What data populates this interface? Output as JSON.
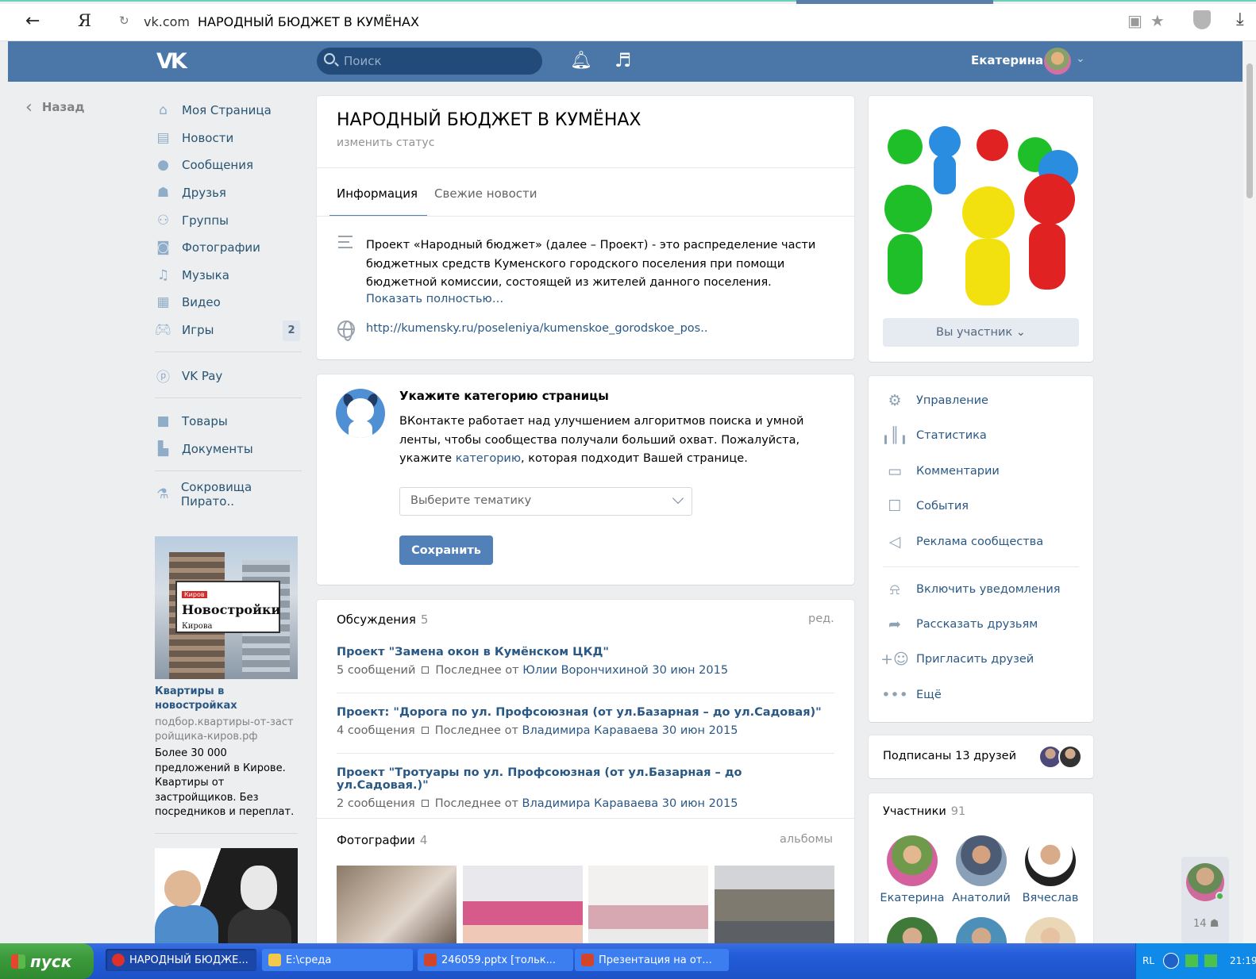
{
  "browser": {
    "back_glyph": "←",
    "ya_logo": "Я",
    "reload_glyph": "↻",
    "domain": "vk.com",
    "page_title": "НАРОДНЫЙ БЮДЖЕТ В КУМЁНАХ",
    "icons": [
      "lock-icon",
      "star-icon",
      "shield-icon",
      "download-icon"
    ]
  },
  "header": {
    "logo": "VK",
    "search_placeholder": "Поиск",
    "user_name": "Екатерина",
    "icons": [
      "bell-icon",
      "music-icon",
      "chevron-down-icon"
    ]
  },
  "back_label": "Назад",
  "left_nav": {
    "items": [
      {
        "label": "Моя Страница",
        "icon": "home-icon"
      },
      {
        "label": "Новости",
        "icon": "news-icon"
      },
      {
        "label": "Сообщения",
        "icon": "messages-icon"
      },
      {
        "label": "Друзья",
        "icon": "friend-icon"
      },
      {
        "label": "Группы",
        "icon": "groups-icon"
      },
      {
        "label": "Фотографии",
        "icon": "camera-icon"
      },
      {
        "label": "Музыка",
        "icon": "music-icon"
      },
      {
        "label": "Видео",
        "icon": "video-icon"
      },
      {
        "label": "Игры",
        "icon": "gamepad-icon",
        "badge": "2"
      }
    ],
    "pay": {
      "label": "VK Pay",
      "icon": "vkpay-icon"
    },
    "items2": [
      {
        "label": "Товары",
        "icon": "bag-icon"
      },
      {
        "label": "Документы",
        "icon": "document-icon"
      }
    ],
    "app": {
      "label": "Сокровища Пирато..",
      "icon": "flask-icon"
    }
  },
  "ads": {
    "ad1": {
      "tag": "Киров",
      "headline": "Новостройки",
      "sub": "Кирова",
      "title": "Квартиры в новостройках",
      "domain": "подбор.квартиры-от-застройщика-киров.рф",
      "text": "Более 30 000 предложений в Кирове. Квартиры от застройщиков. Без посредников и переплат."
    }
  },
  "group": {
    "title": "НАРОДНЫЙ БЮДЖЕТ В КУМЁНАХ",
    "status_link": "изменить статус",
    "tabs": [
      "Информация",
      "Свежие новости"
    ],
    "description": "Проект «Народный бюджет» (далее – Проект) - это распределение части бюджетных средств Куменского городского поселения при помощи бюджетной комиссии, состоящей из жителей данного поселения.",
    "show_more": "Показать полностью…",
    "website": "http://kumensky.ru/poseleniya/kumenskoe_gorodskoe_pos.."
  },
  "category": {
    "title": "Укажите категорию страницы",
    "text_before": "ВКонтакте работает над улучшением алгоритмов поиска и умной ленты, чтобы сообщества получали больший охват. Пожалуйста, укажите ",
    "text_link": "категорию",
    "text_after": ", которая подходит Вашей странице.",
    "select_placeholder": "Выберите тематику",
    "save_label": "Сохранить"
  },
  "discussions": {
    "title": "Обсуждения",
    "count": "5",
    "edit": "ред.",
    "topics": [
      {
        "title": "Проект \"Замена окон в Кумёнском ЦКД\"",
        "count": "5 сообщений",
        "last": "Последнее от",
        "by": "Юлии Ворончихиной 30 июн 2015"
      },
      {
        "title": "Проект: \"Дорога по ул. Профсоюзная (от ул.Базарная – до ул.Садовая)\"",
        "count": "4 сообщения",
        "last": "Последнее от",
        "by": "Владимира Караваева 30 июн 2015"
      },
      {
        "title": "Проект \"Тротуары по ул. Профсоюзная (от ул.Базарная – до ул.Садовая.)\"",
        "count": "2 сообщения",
        "last": "Последнее от",
        "by": "Владимира Караваева 30 июн 2015"
      }
    ]
  },
  "photos": {
    "title": "Фотографии",
    "count": "4",
    "albums": "альбомы"
  },
  "right": {
    "member_button": "Вы участник",
    "manage": [
      {
        "label": "Управление",
        "icon": "gear-icon"
      },
      {
        "label": "Статистика",
        "icon": "stats-icon"
      },
      {
        "label": "Комментарии",
        "icon": "comment-icon"
      },
      {
        "label": "События",
        "icon": "event-icon"
      },
      {
        "label": "Реклама сообщества",
        "icon": "megaphone-icon"
      }
    ],
    "actions": [
      {
        "label": "Включить уведомления",
        "icon": "bell-icon"
      },
      {
        "label": "Рассказать друзьям",
        "icon": "share-icon"
      },
      {
        "label": "Пригласить друзей",
        "icon": "add-user-icon"
      },
      {
        "label": "Ещё",
        "icon": "more-icon"
      }
    ],
    "friends_text": "Подписаны 13 друзей",
    "members_title": "Участники",
    "members_count": "91",
    "members": [
      "Екатерина",
      "Анатолий",
      "Вячеслав"
    ]
  },
  "float_count": "14",
  "taskbar": {
    "start": "пуск",
    "buttons": [
      "НАРОДНЫЙ БЮДЖЕ...",
      "E:\\среда",
      "246059.pptx [тольк...",
      "Презентация на от..."
    ],
    "lang": "RL",
    "time": "21:19"
  }
}
